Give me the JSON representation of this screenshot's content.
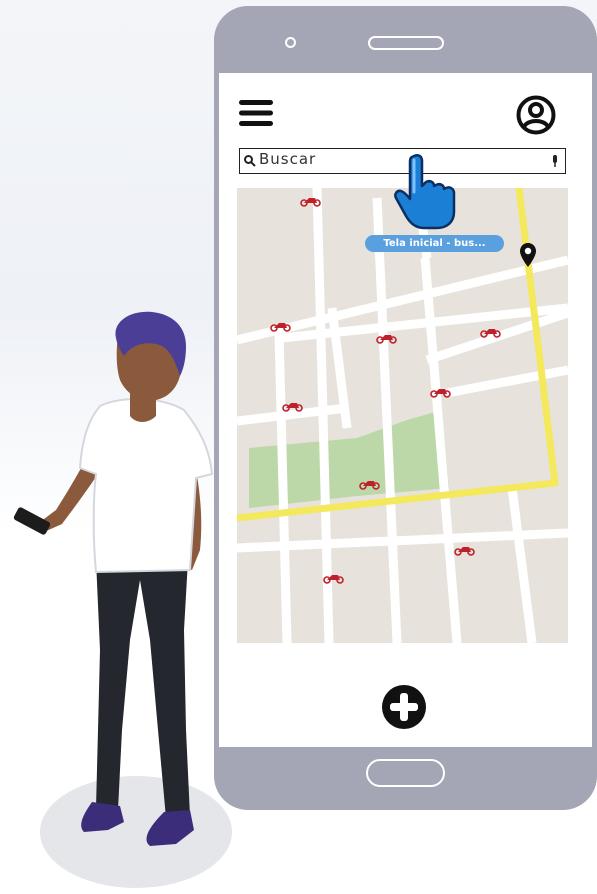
{
  "app": {
    "search_placeholder": "Buscar",
    "tooltip": "Tela inicial - bus..."
  },
  "icons": {
    "menu": "hamburger-menu-icon",
    "profile": "user-profile-icon",
    "search": "magnifier-icon",
    "mic": "microphone-icon",
    "cursor": "pointing-hand-cursor-icon",
    "pin": "location-pin-icon",
    "add": "plus-circle-icon",
    "bike": "motorbike-icon"
  },
  "colors": {
    "phone_frame": "#a4a6b5",
    "map_bg": "#e7e3dc",
    "road": "#ffffff",
    "main_road": "#f4e85c",
    "park": "#bcd7a8",
    "bike": "#c0202a",
    "tooltip": "#5ba0de",
    "cursor": "#1b7fd6"
  }
}
